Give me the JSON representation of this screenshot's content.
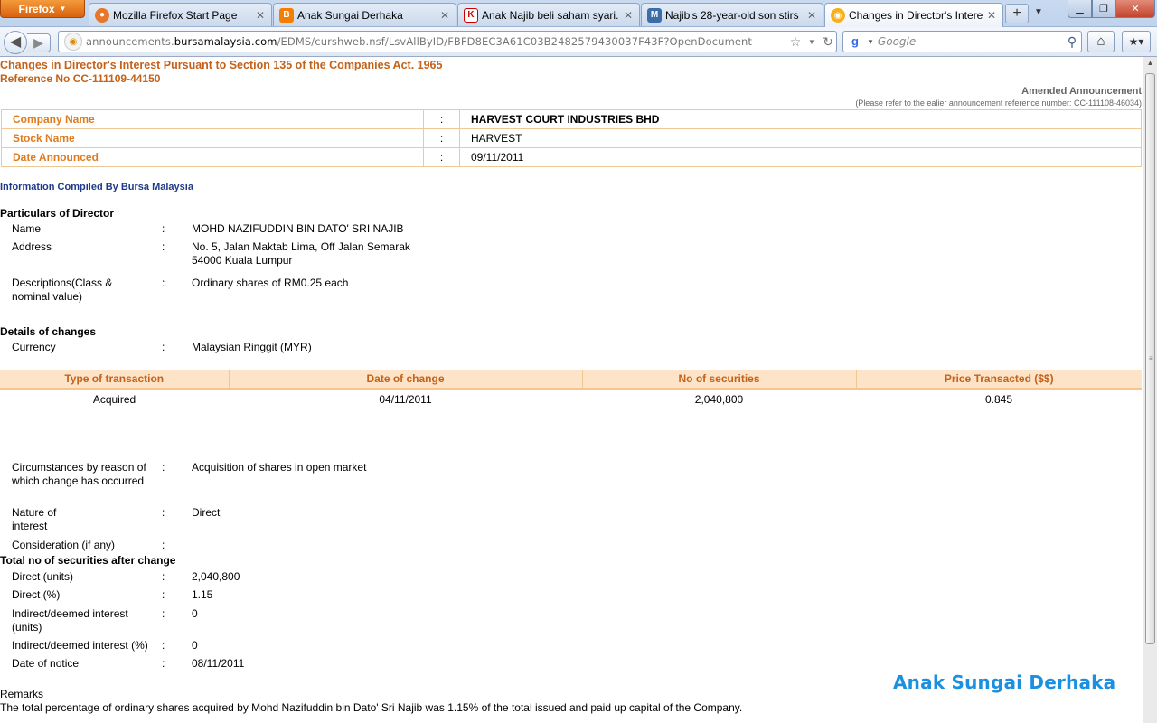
{
  "browser": {
    "menu_label": "Firefox",
    "tabs": [
      {
        "label": "Mozilla Firefox Start Page",
        "icon": "firefox-icon"
      },
      {
        "label": "Anak Sungai Derhaka",
        "icon": "blogger-icon"
      },
      {
        "label": "Anak Najib beli saham syari...",
        "icon": "kd-icon"
      },
      {
        "label": "Najib's 28-year-old son stirs ...",
        "icon": "mk-icon"
      },
      {
        "label": "Changes in Director's Interes...",
        "icon": "bursa-icon"
      }
    ],
    "url_prefix": "announcements.",
    "url_host": "bursamalaysia.com",
    "url_path": "/EDMS/curshweb.nsf/LsvAllByID/FBFD8EC3A61C03B2482579430037F43F?OpenDocument",
    "search_placeholder": "Google"
  },
  "page": {
    "title": "Changes in Director's Interest Pursuant to Section 135 of the Companies Act. 1965",
    "reference": "Reference No CC-111109-44150",
    "amended": "Amended Announcement",
    "amended_note": "(Please refer to the ealier announcement reference number: CC-111108-46034)",
    "company": [
      {
        "key": "Company Name",
        "sep": ":",
        "value": "HARVEST COURT INDUSTRIES BHD"
      },
      {
        "key": "Stock Name",
        "sep": ":",
        "value": "HARVEST"
      },
      {
        "key": "Date Announced",
        "sep": ":",
        "value": "09/11/2011"
      }
    ],
    "compiled_by": "Information Compiled By Bursa Malaysia",
    "particulars_heading": "Particulars of Director",
    "name_label": "Name",
    "name_value": "MOHD NAZIFUDDIN BIN DATO' SRI NAJIB",
    "address_label": "Address",
    "address_line1": "No. 5, Jalan Maktab Lima, Off Jalan Semarak",
    "address_line2": "54000 Kuala Lumpur",
    "desc_label": "Descriptions(Class & nominal value)",
    "desc_value": "Ordinary shares of RM0.25 each",
    "changes_heading": "Details of changes",
    "currency_label": "Currency",
    "currency_value": "Malaysian Ringgit (MYR)",
    "tx_headers": [
      "Type of transaction",
      "Date of change",
      "No of securities",
      "Price Transacted ($$)"
    ],
    "tx_row": [
      "Acquired",
      "04/11/2011",
      "2,040,800",
      "0.845"
    ],
    "circ_label": "Circumstances by reason of which change has occurred",
    "circ_value": "Acquisition of shares in open market",
    "nature_label": "Nature of interest",
    "nature_value": "Direct",
    "consideration_label": "Consideration (if any)",
    "total_heading": "Total no of securities after change",
    "direct_units_label": "Direct (units)",
    "direct_units_value": "2,040,800",
    "direct_pct_label": "Direct (%)",
    "direct_pct_value": "1.15",
    "indirect_units_label": "Indirect/deemed interest (units)",
    "indirect_units_value": "0",
    "indirect_pct_label": "Indirect/deemed interest (%)",
    "indirect_pct_value": "0",
    "notice_label": "Date of notice",
    "notice_value": "08/11/2011",
    "remarks_label": "Remarks",
    "remarks_text": "The total percentage of ordinary shares acquired by Mohd Nazifuddin bin Dato' Sri Najib was 1.15% of the total issued and paid up capital of the Company.",
    "watermark": "Anak Sungai Derhaka",
    "colon": ":"
  }
}
